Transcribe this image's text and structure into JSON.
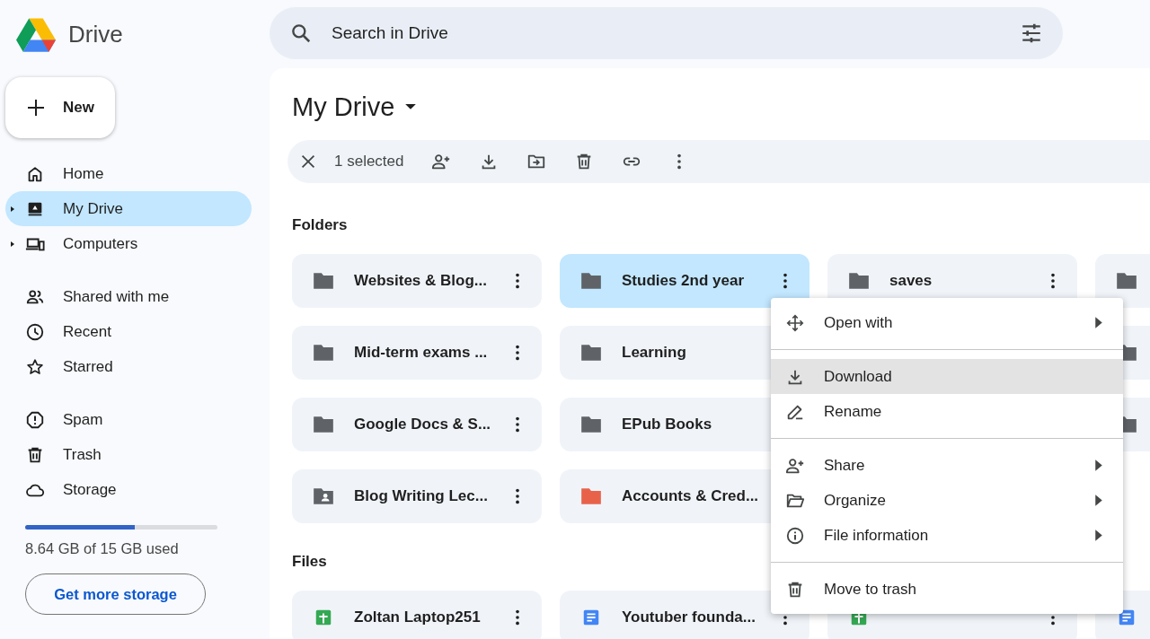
{
  "app": {
    "name": "Drive"
  },
  "search": {
    "placeholder": "Search in Drive"
  },
  "new_button": {
    "label": "New"
  },
  "nav": [
    [
      {
        "label": "Home",
        "selected": false,
        "expandable": false
      },
      {
        "label": "My Drive",
        "selected": true,
        "expandable": true
      },
      {
        "label": "Computers",
        "selected": false,
        "expandable": true
      }
    ],
    [
      {
        "label": "Shared with me",
        "selected": false,
        "expandable": false
      },
      {
        "label": "Recent",
        "selected": false,
        "expandable": false
      },
      {
        "label": "Starred",
        "selected": false,
        "expandable": false
      }
    ],
    [
      {
        "label": "Spam",
        "selected": false,
        "expandable": false
      },
      {
        "label": "Trash",
        "selected": false,
        "expandable": false
      },
      {
        "label": "Storage",
        "selected": false,
        "expandable": false
      }
    ]
  ],
  "storage": {
    "level": 0.57,
    "usage": "8.64 GB of 15 GB used",
    "button": "Get more storage"
  },
  "page_title": "My Drive",
  "selection_bar": {
    "count": "1 selected"
  },
  "folders": {
    "heading": "Folders",
    "items": [
      {
        "kind": "folder",
        "name": "Websites & Blog...",
        "selected": false
      },
      {
        "kind": "folder",
        "name": "Studies 2nd year",
        "selected": true
      },
      {
        "kind": "folder",
        "name": "saves",
        "selected": false
      },
      {
        "kind": "folder",
        "selected": false
      },
      {
        "kind": "folder",
        "name": "Mid-term exams ...",
        "selected": false
      },
      {
        "kind": "folder",
        "name": "Learning",
        "selected": false
      },
      {
        "kind": "covered"
      },
      {
        "kind": "folder",
        "selected": false
      },
      {
        "kind": "folder",
        "name": "Google Docs & S...",
        "selected": false
      },
      {
        "kind": "folder",
        "name": "EPub Books",
        "selected": false
      },
      {
        "kind": "covered"
      },
      {
        "kind": "folder",
        "selected": false
      },
      {
        "kind": "shared-folder",
        "name": "Blog Writing Lec...",
        "selected": false
      },
      {
        "kind": "folder",
        "name": "Accounts & Cred...",
        "selected": false,
        "color": "#e8624a"
      },
      {
        "kind": "covered"
      },
      {
        "kind": "covered"
      }
    ]
  },
  "files": {
    "heading": "Files",
    "items": [
      {
        "kind": "sheet",
        "name": "Zoltan Laptop251",
        "selected": false
      },
      {
        "kind": "doc",
        "name": "Youtuber founda...",
        "selected": false
      },
      {
        "kind": "sheet",
        "selected": false
      },
      {
        "kind": "doc",
        "selected": false
      }
    ]
  },
  "context_menu": [
    [
      {
        "label": "Open with",
        "submenu": true,
        "selected": false
      }
    ],
    [
      {
        "label": "Download",
        "submenu": false,
        "selected": true
      },
      {
        "label": "Rename",
        "submenu": false,
        "selected": false
      }
    ],
    [
      {
        "label": "Share",
        "submenu": true,
        "selected": false
      },
      {
        "label": "Organize",
        "submenu": true,
        "selected": false
      },
      {
        "label": "File information",
        "submenu": true,
        "selected": false
      }
    ],
    [
      {
        "label": "Move to trash",
        "submenu": false,
        "selected": false
      }
    ]
  ]
}
